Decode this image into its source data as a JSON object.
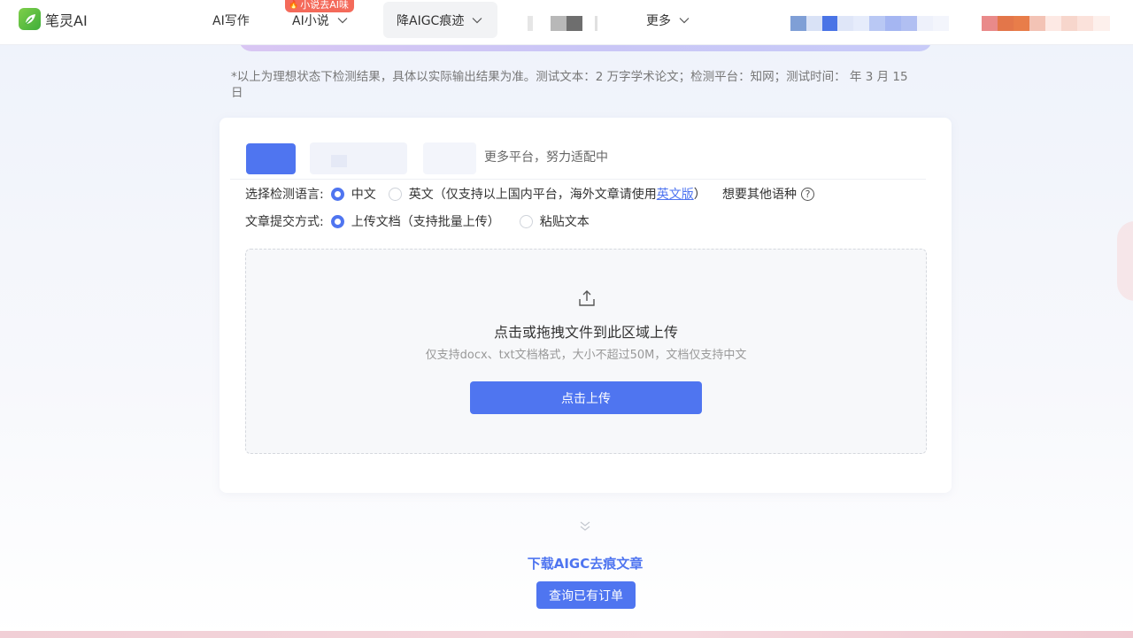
{
  "nav": {
    "logo_text": "笔灵AI",
    "writing": "AI写作",
    "novel": "AI小说",
    "novel_badge": "小说去AI味",
    "aigc": "降AIGC痕迹",
    "more": "更多"
  },
  "note": "*以上为理想状态下检测结果，具体以实际输出结果为准。测试文本：2 万字学术论文；检测平台：知网；测试时间：     年 3 月 15 日",
  "platforms": {
    "more_text": "更多平台，努力适配中"
  },
  "language": {
    "label": "选择检测语言:",
    "chinese": "中文",
    "english_prefix": "英文（仅支持以上国内平台，海外文章请使用",
    "english_link": "英文版",
    "english_suffix": "）",
    "other": "想要其他语种",
    "help": "?"
  },
  "submit": {
    "label": "文章提交方式:",
    "upload": "上传文档（支持批量上传）",
    "paste": "粘贴文本"
  },
  "dropzone": {
    "title": "点击或拖拽文件到此区域上传",
    "subtitle": "仅支持docx、txt文档格式，大小不超过50M，文档仅支持中文",
    "button": "点击上传"
  },
  "download": {
    "title": "下载AIGC去痕文章",
    "order_button": "查询已有订单"
  },
  "colors": {
    "accent": "#4f75f0",
    "badge": "#f46a5a"
  }
}
